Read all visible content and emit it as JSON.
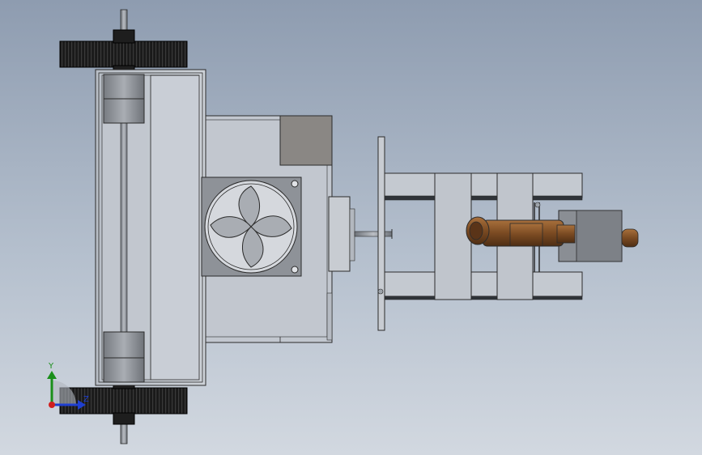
{
  "viewport": {
    "background_top": "#8e9cb0",
    "background_bottom": "#d2d8e0"
  },
  "triad": {
    "y_label": "Y",
    "z_label": "Z",
    "y_color": "#1a8f1a",
    "z_color": "#1f3fd0",
    "x_color": "#d01f1f"
  },
  "model": {
    "colors": {
      "metal": "#c8ccd2",
      "metal_dark": "#9ea4ab",
      "edge": "#2b2b2b",
      "tire": "#1a1a1a",
      "motor": "#8a8e94",
      "brass": "#7a4a22",
      "brass_light": "#a8703c",
      "grey_block": "#8a8784"
    }
  }
}
